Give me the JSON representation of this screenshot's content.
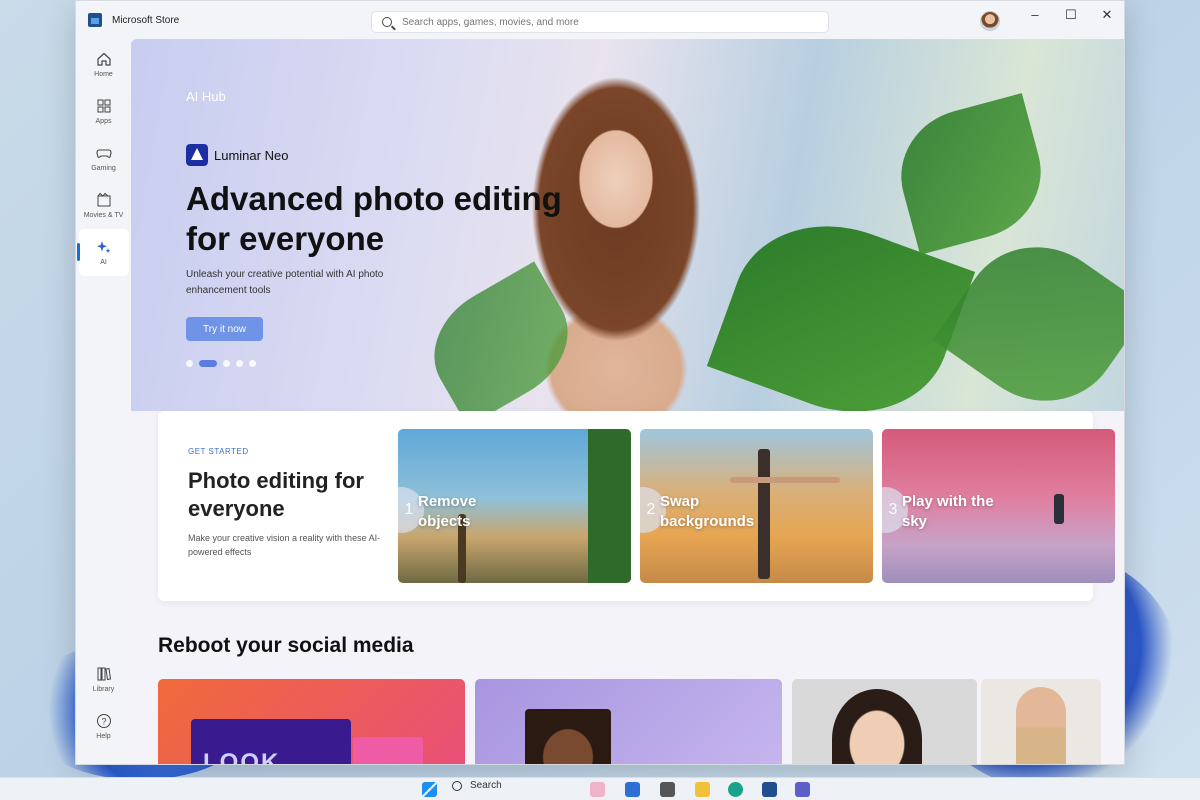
{
  "window": {
    "app_title": "Microsoft Store",
    "search_placeholder": "Search apps, games, movies, and more",
    "controls": {
      "minimize": "–",
      "maximize": "☐",
      "close": "✕"
    }
  },
  "sidebar": {
    "items": [
      {
        "label": "Home",
        "icon": "home-icon"
      },
      {
        "label": "Apps",
        "icon": "apps-icon"
      },
      {
        "label": "Gaming",
        "icon": "gamepad-icon"
      },
      {
        "label": "Movies & TV",
        "icon": "film-icon"
      },
      {
        "label": "AI",
        "icon": "sparkle-icon",
        "active": true
      }
    ],
    "bottom": [
      {
        "label": "Library",
        "icon": "library-icon"
      },
      {
        "label": "Help",
        "icon": "help-icon"
      }
    ]
  },
  "hero": {
    "eyebrow": "AI Hub",
    "brand": "Luminar Neo",
    "title": "Advanced photo editing for everyone",
    "subtitle": "Unleash your creative potential with AI photo enhancement tools",
    "cta": "Try it now",
    "carousel_total": 5,
    "carousel_active": 2
  },
  "get_started": {
    "eyebrow": "GET STARTED",
    "title": "Photo editing for everyone",
    "subtitle": "Make your creative vision a reality with these AI-powered effects",
    "steps": [
      {
        "num": "1",
        "label": "Remove objects"
      },
      {
        "num": "2",
        "label": "Swap backgrounds"
      },
      {
        "num": "3",
        "label": "Play with the sky"
      }
    ]
  },
  "social": {
    "title": "Reboot your social media",
    "tile1_card_text": "LOOK"
  },
  "taskbar": {
    "search_label": "Search"
  }
}
